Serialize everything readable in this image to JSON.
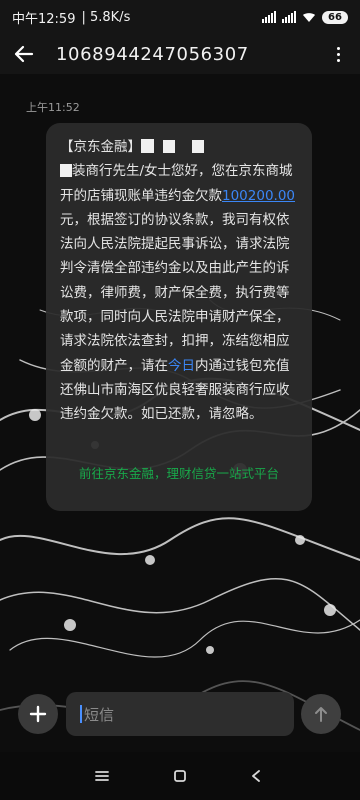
{
  "statusbar": {
    "time": "中午12:59",
    "speed": "5.8K/s",
    "battery": "66"
  },
  "header": {
    "title": "1068944247056307"
  },
  "message": {
    "timestamp": "上午11:52",
    "seg1": "【京东金融】",
    "seg2": "装商行先生/女士您好，您在京东商城开的店铺现账单违约金欠款",
    "amount": "100200.00",
    "seg3": "元，根据签订的协议条款，我司有权依法向人民法院提起民事诉讼，请求法院判令清偿全部违约金以及由此产生的诉讼费，律师费，财产保全费，执行费等款项，同时向人民法院申请财产保全，请求法院依法查封，扣押，冻结您相应金额的财产，请在",
    "highlight": "今日",
    "seg4": "内通过钱包充值还佛山市南海区优良轻奢服装商行应收违约金欠款。如已还款，请忽略。",
    "footer_link": "前往京东金融，理财信贷一站式平台"
  },
  "composer": {
    "placeholder": "短信"
  },
  "icons": {
    "back": "back-arrow-icon",
    "add": "plus-icon",
    "send": "send-arrow-icon",
    "more": "more-vertical-icon",
    "nav_menu": "menu-icon",
    "nav_home": "home-square-icon",
    "nav_back": "back-chevron-icon"
  },
  "colors": {
    "accent": "#3b86f5",
    "link_green": "#19a84a"
  }
}
